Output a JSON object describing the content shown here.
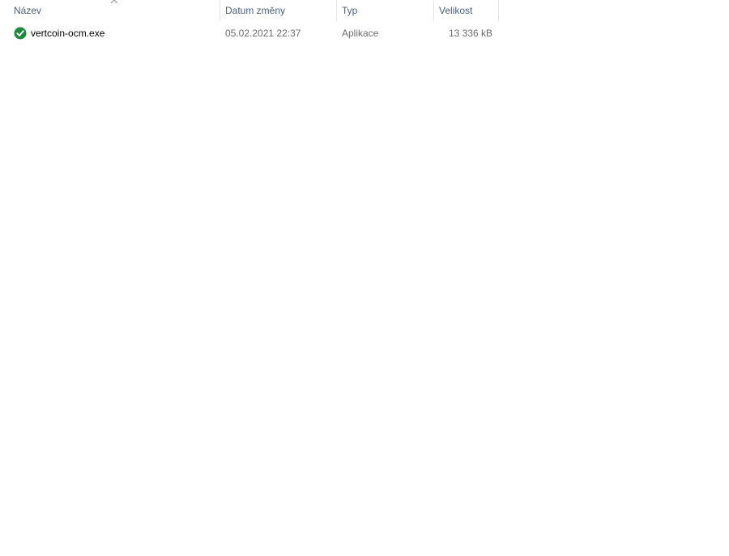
{
  "columns": {
    "name": "Název",
    "date": "Datum změny",
    "type": "Typ",
    "size": "Velikost"
  },
  "sort": {
    "column": "name",
    "direction": "ascending",
    "icon": "chevron-up-icon"
  },
  "files": [
    {
      "name": "vertcoin-ocm.exe",
      "date": "05.02.2021 22:37",
      "type": "Aplikace",
      "size": "13 336 kB",
      "status_icon": "synced-check-icon",
      "status_color": "#1b8a3c"
    }
  ],
  "colors": {
    "header_text": "#4c607a",
    "detail_text": "#6d6d6d",
    "divider": "#e5e5e5"
  }
}
